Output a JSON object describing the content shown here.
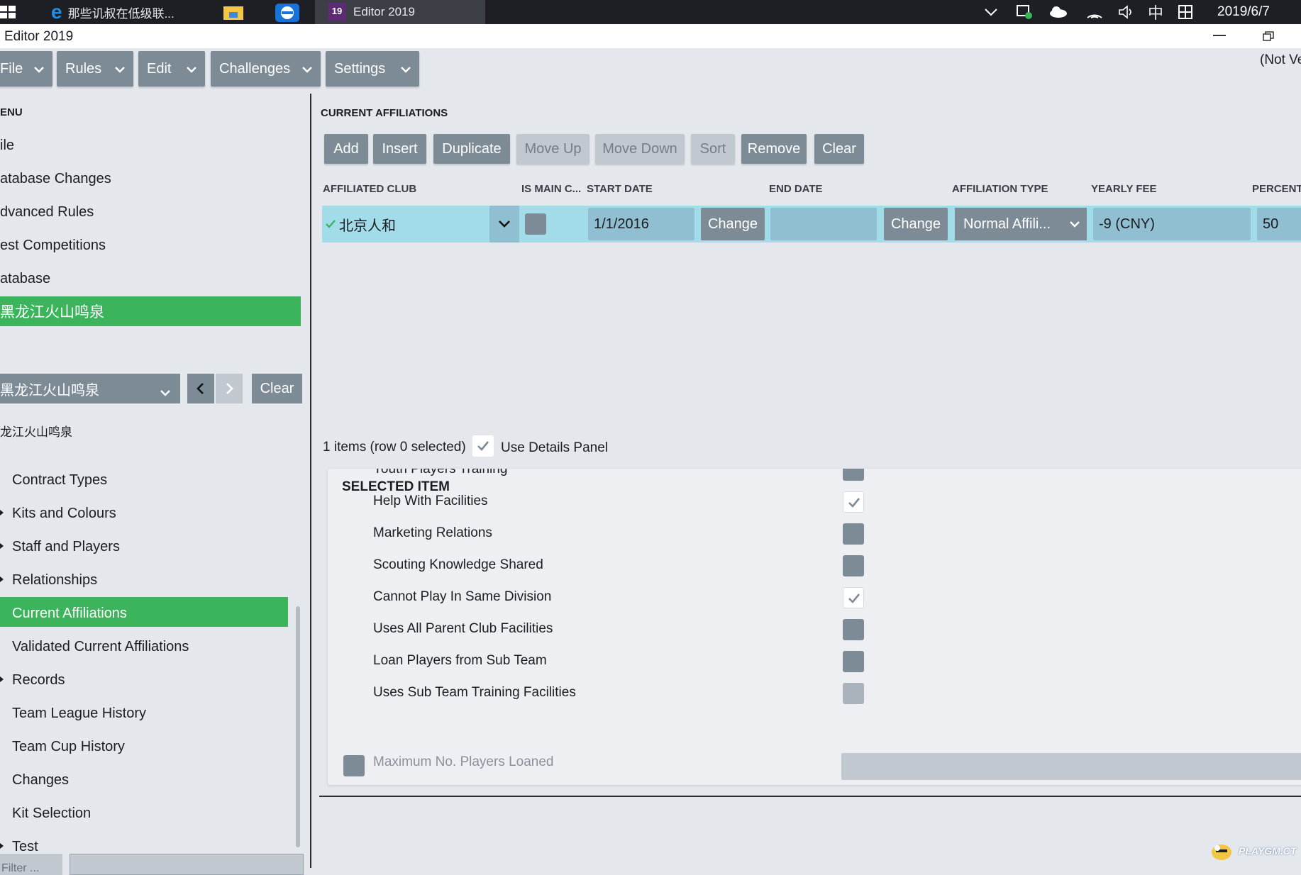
{
  "taskbar": {
    "window1_title": "那些讥叔在低级联...",
    "window2_title": "Editor 2019",
    "clock_date": "2019/6/7",
    "ime": "中"
  },
  "app": {
    "title": "Editor 2019",
    "not_verified": "(Not Ve"
  },
  "menus": [
    "File",
    "Rules",
    "Edit",
    "Challenges",
    "Settings"
  ],
  "left": {
    "menu_heading": "ENU",
    "menu_items": [
      "ile",
      "atabase Changes",
      "dvanced Rules",
      "est Competitions",
      "atabase"
    ],
    "selected_item": "黑龙江火山鸣泉",
    "club_dropdown": "黑龙江火山鸣泉",
    "clear_label": "Clear",
    "club_heading": "龙江火山鸣泉",
    "tree": [
      {
        "label": "Contract Types",
        "arrow": false
      },
      {
        "label": "Kits and Colours",
        "arrow": true
      },
      {
        "label": "Staff and Players",
        "arrow": true
      },
      {
        "label": "Relationships",
        "arrow": true
      },
      {
        "label": "Current Affiliations",
        "arrow": false,
        "selected": true
      },
      {
        "label": "Validated Current Affiliations",
        "arrow": false
      },
      {
        "label": "Records",
        "arrow": true
      },
      {
        "label": "Team League History",
        "arrow": false
      },
      {
        "label": "Team Cup History",
        "arrow": false
      },
      {
        "label": "Changes",
        "arrow": false
      },
      {
        "label": "Kit Selection",
        "arrow": false
      },
      {
        "label": "Test",
        "arrow": true
      }
    ],
    "filter_label": "Filter ..."
  },
  "affiliations": {
    "title": "CURRENT AFFILIATIONS",
    "actions": [
      {
        "label": "Add",
        "enabled": true
      },
      {
        "label": "Insert",
        "enabled": true
      },
      {
        "label": "Duplicate",
        "enabled": true
      },
      {
        "label": "Move Up",
        "enabled": false
      },
      {
        "label": "Move Down",
        "enabled": false
      },
      {
        "label": "Sort",
        "enabled": false
      },
      {
        "label": "Remove",
        "enabled": true
      },
      {
        "label": "Clear",
        "enabled": true
      }
    ],
    "columns": [
      "AFFILIATED CLUB",
      "IS MAIN C...",
      "START DATE",
      "END DATE",
      "AFFILIATION TYPE",
      "YEARLY FEE",
      "PERCENT"
    ],
    "row": {
      "club": "北京人和",
      "start_date": "1/1/2016",
      "change_label": "Change",
      "end_date": "",
      "affiliation_type": "Normal Affili...",
      "yearly_fee": "-9 (CNY)",
      "percent": "50"
    },
    "items_count": "1 items (row 0 selected)",
    "use_details_label": "Use Details Panel"
  },
  "detail": {
    "title": "SELECTED ITEM",
    "options": [
      {
        "label": "Youth Players Training",
        "checked": false
      },
      {
        "label": "Help With Facilities",
        "checked": true
      },
      {
        "label": "Marketing Relations",
        "checked": false
      },
      {
        "label": "Scouting Knowledge Shared",
        "checked": false
      },
      {
        "label": "Cannot Play In Same Division",
        "checked": true
      },
      {
        "label": "Uses All Parent Club Facilities",
        "checked": false
      },
      {
        "label": "Loan Players from Sub Team",
        "checked": false
      },
      {
        "label": "Uses Sub Team Training Facilities",
        "checked": false
      }
    ],
    "max_loaned_label": "Maximum No. Players Loaned"
  },
  "watermark": "PLAYGM.CT",
  "colors": {
    "accent_green": "#3bb45c",
    "button_gray": "#7c8b96",
    "row_highlight": "#a2dce8"
  }
}
